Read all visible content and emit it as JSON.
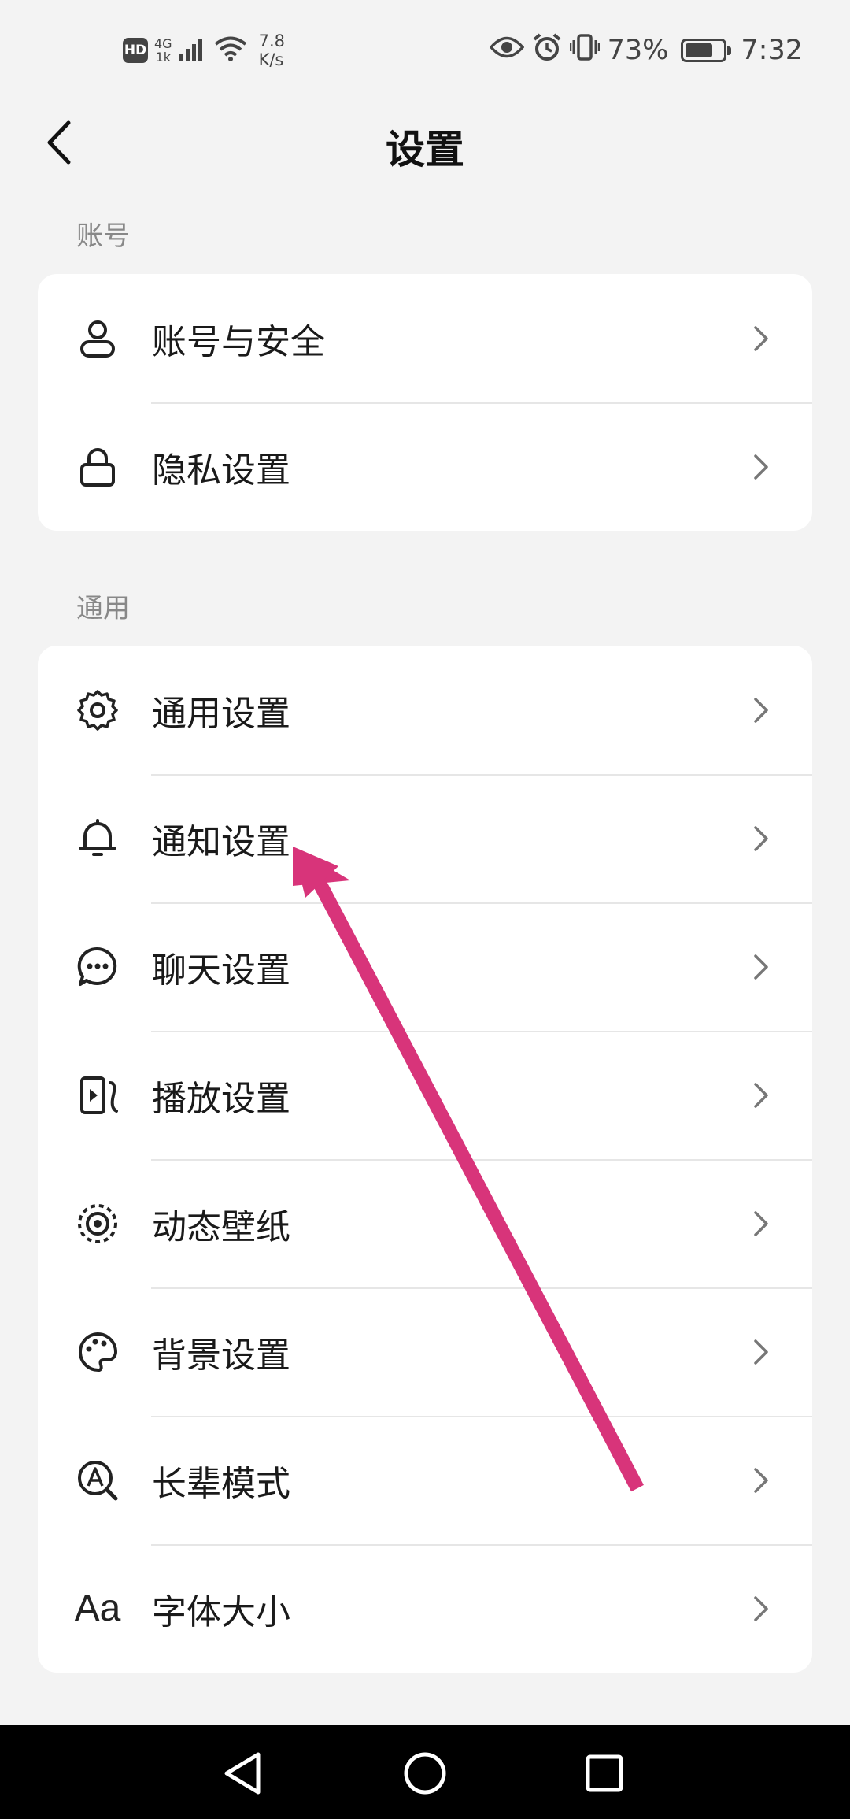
{
  "status_bar": {
    "hd": "HD",
    "net_type_top": "4G",
    "net_type_bottom": "1k",
    "speed_value": "7.8",
    "speed_unit": "K/s",
    "battery_percent": "73%",
    "battery_level": 0.73,
    "time": "7:32"
  },
  "header": {
    "title": "设置"
  },
  "sections": [
    {
      "label": "账号",
      "items": [
        {
          "label": "账号与安全",
          "icon": "person-icon"
        },
        {
          "label": "隐私设置",
          "icon": "lock-icon"
        }
      ]
    },
    {
      "label": "通用",
      "items": [
        {
          "label": "通用设置",
          "icon": "gear-icon"
        },
        {
          "label": "通知设置",
          "icon": "bell-icon"
        },
        {
          "label": "聊天设置",
          "icon": "chat-bubble-icon"
        },
        {
          "label": "播放设置",
          "icon": "play-icon"
        },
        {
          "label": "动态壁纸",
          "icon": "wallpaper-icon"
        },
        {
          "label": "背景设置",
          "icon": "palette-icon"
        },
        {
          "label": "长辈模式",
          "icon": "elder-mode-icon"
        },
        {
          "label": "字体大小",
          "icon": "font-size-icon",
          "icon_text": "Aa"
        }
      ]
    }
  ],
  "colors": {
    "background": "#f3f3f3",
    "card": "#ffffff",
    "annotation_arrow": "#d8347a",
    "nav_bar": "#000000"
  }
}
